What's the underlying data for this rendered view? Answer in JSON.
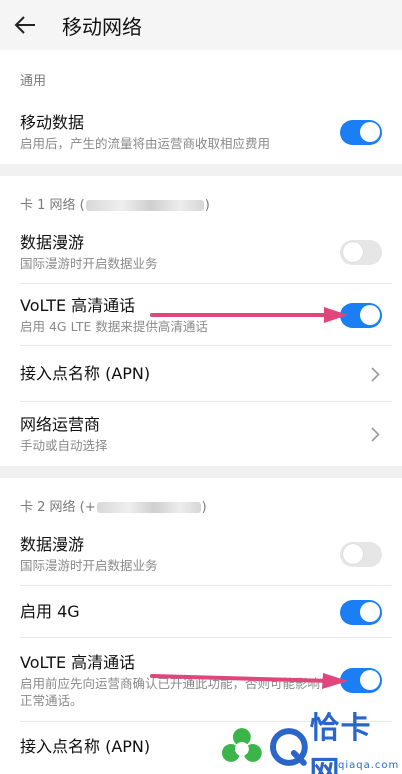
{
  "header": {
    "title": "移动网络"
  },
  "general": {
    "label": "通用",
    "mobile_data": {
      "title": "移动数据",
      "subtitle": "启用后，产生的流量将由运营商收取相应费用",
      "on": true
    }
  },
  "sim1": {
    "label_prefix": "卡 1 网络 (",
    "label_suffix": ")",
    "roaming": {
      "title": "数据漫游",
      "subtitle": "国际漫游时开启数据业务",
      "on": false
    },
    "volte": {
      "title": "VoLTE 高清通话",
      "subtitle": "启用 4G LTE 数据来提供高清通话",
      "on": true
    },
    "apn": {
      "title": "接入点名称 (APN)"
    },
    "operator": {
      "title": "网络运营商",
      "subtitle": "手动或自动选择"
    }
  },
  "sim2": {
    "label_prefix": "卡 2 网络 (+",
    "label_suffix": ")",
    "roaming": {
      "title": "数据漫游",
      "subtitle": "国际漫游时开启数据业务",
      "on": false
    },
    "enable_4g": {
      "title": "启用 4G",
      "on": true
    },
    "volte": {
      "title": "VoLTE 高清通话",
      "subtitle": "启用前应先向运营商确认已开通此功能，否则可能影响正常通话。",
      "on": true
    },
    "apn": {
      "title": "接入点名称 (APN)"
    }
  },
  "watermark": {
    "text": "恰卡网",
    "sub": "qiaqa.com"
  },
  "colors": {
    "accent": "#1a7ff5",
    "arrow": "#e0457b",
    "watermark": "#2a66c8"
  }
}
